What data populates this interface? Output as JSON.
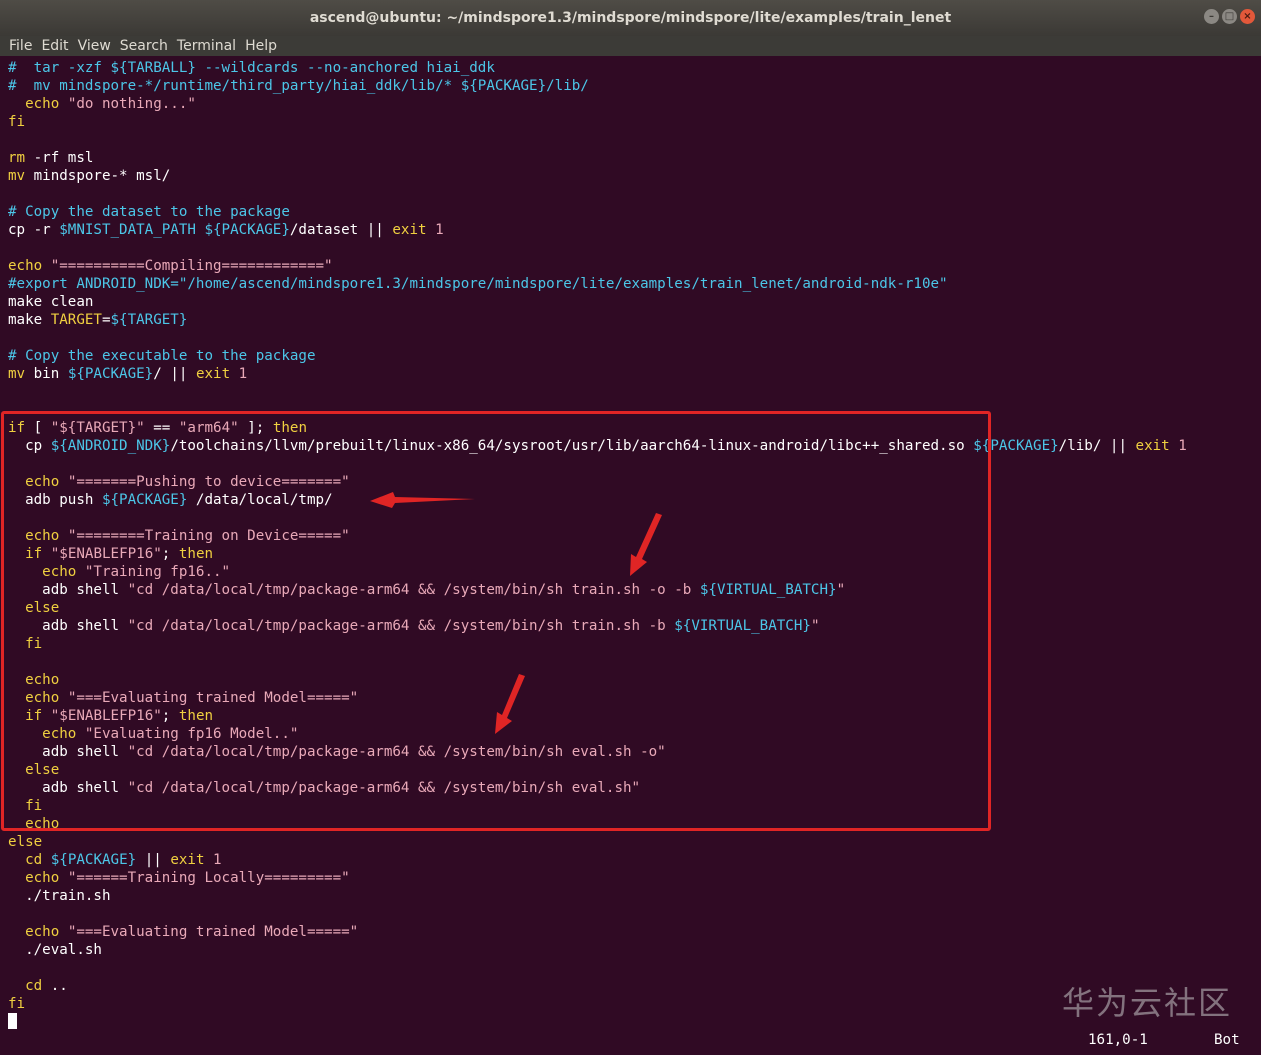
{
  "window": {
    "title": "ascend@ubuntu: ~/mindspore1.3/mindspore/mindspore/lite/examples/train_lenet",
    "controls": [
      "–",
      "□",
      "×"
    ]
  },
  "menu": [
    "File",
    "Edit",
    "View",
    "Search",
    "Terminal",
    "Help"
  ],
  "lines": [
    [
      [
        "#  tar -xzf ${TARBALL} --wildcards --no-anchored hiai_ddk",
        "cm"
      ]
    ],
    [
      [
        "#  mv mindspore-*/runtime/third_party/hiai_ddk/lib/* ${PACKAGE}/lib/",
        "cm"
      ]
    ],
    [
      [
        "  ",
        ""
      ],
      [
        "echo",
        "kw"
      ],
      [
        " ",
        ""
      ],
      [
        "\"do nothing...\"",
        "str"
      ]
    ],
    [
      [
        "fi",
        "kw"
      ]
    ],
    [],
    [
      [
        "rm",
        "cmd"
      ],
      [
        " -rf msl",
        ""
      ]
    ],
    [
      [
        "mv",
        "cmd"
      ],
      [
        " mindspore-* msl/",
        ""
      ]
    ],
    [],
    [
      [
        "# Copy the dataset to the package",
        "cm"
      ]
    ],
    [
      [
        "cp -r ",
        ""
      ],
      [
        "$MNIST_DATA_PATH",
        "var"
      ],
      [
        " ",
        ""
      ],
      [
        "${PACKAGE}",
        "var"
      ],
      [
        "/dataset || ",
        ""
      ],
      [
        "exit",
        "kw"
      ],
      [
        " ",
        ""
      ],
      [
        "1",
        "num"
      ]
    ],
    [],
    [
      [
        "echo",
        "kw"
      ],
      [
        " ",
        ""
      ],
      [
        "\"==========Compiling============\"",
        "str"
      ]
    ],
    [
      [
        "#export ANDROID_NDK=\"/home/ascend/mindspore1.3/mindspore/mindspore/lite/examples/train_lenet/android-ndk-r10e\"",
        "cm"
      ]
    ],
    [
      [
        "make clean",
        ""
      ]
    ],
    [
      [
        "make ",
        ""
      ],
      [
        "TARGET",
        "kw"
      ],
      [
        "=",
        ""
      ],
      [
        "${TARGET}",
        "var"
      ]
    ],
    [],
    [
      [
        "# Copy the executable to the package",
        "cm"
      ]
    ],
    [
      [
        "mv",
        "cmd"
      ],
      [
        " bin ",
        ""
      ],
      [
        "${PACKAGE}",
        "var"
      ],
      [
        "/ || ",
        ""
      ],
      [
        "exit",
        "kw"
      ],
      [
        " ",
        ""
      ],
      [
        "1",
        "num"
      ]
    ],
    [],
    [],
    [
      [
        "if",
        "kw"
      ],
      [
        " [ ",
        ""
      ],
      [
        "\"${TARGET}\"",
        "str"
      ],
      [
        " == ",
        ""
      ],
      [
        "\"arm64\"",
        "str"
      ],
      [
        " ]; ",
        ""
      ],
      [
        "then",
        "kw"
      ]
    ],
    [
      [
        "  cp ",
        ""
      ],
      [
        "${ANDROID_NDK}",
        "var"
      ],
      [
        "/toolchains/llvm/prebuilt/linux-x86_64/sysroot/usr/lib/aarch64-linux-android/libc++_shared.so ",
        ""
      ],
      [
        "${PACKAGE}",
        "var"
      ],
      [
        "/lib/ || ",
        ""
      ],
      [
        "exit",
        "kw"
      ],
      [
        " ",
        ""
      ],
      [
        "1",
        "num"
      ]
    ],
    [],
    [
      [
        "  ",
        ""
      ],
      [
        "echo",
        "kw"
      ],
      [
        " ",
        ""
      ],
      [
        "\"=======Pushing to device=======\"",
        "str"
      ]
    ],
    [
      [
        "  adb push ",
        ""
      ],
      [
        "${PACKAGE}",
        "var"
      ],
      [
        " /data/local/tmp/",
        ""
      ]
    ],
    [],
    [
      [
        "  ",
        ""
      ],
      [
        "echo",
        "kw"
      ],
      [
        " ",
        ""
      ],
      [
        "\"========Training on Device=====\"",
        "str"
      ]
    ],
    [
      [
        "  ",
        ""
      ],
      [
        "if",
        "kw"
      ],
      [
        " ",
        ""
      ],
      [
        "\"$ENABLEFP16\"",
        "str"
      ],
      [
        "; ",
        ""
      ],
      [
        "then",
        "kw"
      ]
    ],
    [
      [
        "    ",
        ""
      ],
      [
        "echo",
        "kw"
      ],
      [
        " ",
        ""
      ],
      [
        "\"Training fp16..\"",
        "str"
      ]
    ],
    [
      [
        "    adb shell ",
        ""
      ],
      [
        "\"cd /data/local/tmp/package-arm64 && /system/bin/sh train.sh -o -b ",
        "str"
      ],
      [
        "${VIRTUAL_BATCH}",
        "var"
      ],
      [
        "\"",
        "str"
      ]
    ],
    [
      [
        "  ",
        ""
      ],
      [
        "else",
        "kw"
      ]
    ],
    [
      [
        "    adb shell ",
        ""
      ],
      [
        "\"cd /data/local/tmp/package-arm64 && /system/bin/sh train.sh -b ",
        "str"
      ],
      [
        "${VIRTUAL_BATCH}",
        "var"
      ],
      [
        "\"",
        "str"
      ]
    ],
    [
      [
        "  ",
        ""
      ],
      [
        "fi",
        "kw"
      ]
    ],
    [],
    [
      [
        "  ",
        ""
      ],
      [
        "echo",
        "kw"
      ]
    ],
    [
      [
        "  ",
        ""
      ],
      [
        "echo",
        "kw"
      ],
      [
        " ",
        ""
      ],
      [
        "\"===Evaluating trained Model=====\"",
        "str"
      ]
    ],
    [
      [
        "  ",
        ""
      ],
      [
        "if",
        "kw"
      ],
      [
        " ",
        ""
      ],
      [
        "\"$ENABLEFP16\"",
        "str"
      ],
      [
        "; ",
        ""
      ],
      [
        "then",
        "kw"
      ]
    ],
    [
      [
        "    ",
        ""
      ],
      [
        "echo",
        "kw"
      ],
      [
        " ",
        ""
      ],
      [
        "\"Evaluating fp16 Model..\"",
        "str"
      ]
    ],
    [
      [
        "    adb shell ",
        ""
      ],
      [
        "\"cd /data/local/tmp/package-arm64 && /system/bin/sh eval.sh -o\"",
        "str"
      ]
    ],
    [
      [
        "  ",
        ""
      ],
      [
        "else",
        "kw"
      ]
    ],
    [
      [
        "    adb shell ",
        ""
      ],
      [
        "\"cd /data/local/tmp/package-arm64 && /system/bin/sh eval.sh\"",
        "str"
      ]
    ],
    [
      [
        "  ",
        ""
      ],
      [
        "fi",
        "kw"
      ]
    ],
    [
      [
        "  ",
        ""
      ],
      [
        "echo",
        "kw"
      ]
    ],
    [
      [
        "else",
        "kw"
      ]
    ],
    [
      [
        "  ",
        ""
      ],
      [
        "cd",
        "kw"
      ],
      [
        " ",
        ""
      ],
      [
        "${PACKAGE}",
        "var"
      ],
      [
        " || ",
        ""
      ],
      [
        "exit",
        "kw"
      ],
      [
        " ",
        ""
      ],
      [
        "1",
        "num"
      ]
    ],
    [
      [
        "  ",
        ""
      ],
      [
        "echo",
        "kw"
      ],
      [
        " ",
        ""
      ],
      [
        "\"======Training Locally=========\"",
        "str"
      ]
    ],
    [
      [
        "  ./train.sh",
        ""
      ]
    ],
    [],
    [
      [
        "  ",
        ""
      ],
      [
        "echo",
        "kw"
      ],
      [
        " ",
        ""
      ],
      [
        "\"===Evaluating trained Model=====\"",
        "str"
      ]
    ],
    [
      [
        "  ./eval.sh",
        ""
      ]
    ],
    [],
    [
      [
        "  ",
        ""
      ],
      [
        "cd",
        "kw"
      ],
      [
        " ..",
        ""
      ]
    ],
    [
      [
        "fi",
        "kw"
      ]
    ]
  ],
  "status": {
    "position": "161,0-1",
    "scroll": "Bot"
  },
  "watermark": "华为云社区"
}
